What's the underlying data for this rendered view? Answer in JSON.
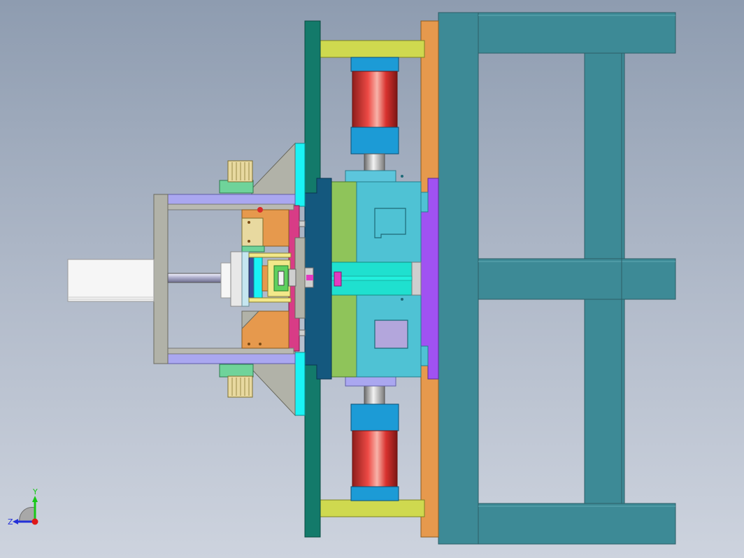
{
  "viewport": {
    "background_top": "#8e9cb0",
    "background_bottom": "#cdd3de"
  },
  "axes": {
    "y_label": "Y",
    "z_label": "Z",
    "y_color": "#17c817",
    "z_color": "#2430d8",
    "x_color": "#e01818"
  },
  "colors": {
    "frame_teal": "#3d8a96",
    "orange_plate": "#e6994d",
    "dark_green_plate": "#137a6a",
    "yellow_clamp": "#cfd94f",
    "cylinder_red": "#d9322f",
    "cylinder_blue": "#1c9bd6",
    "mold_cyan": "#4fc2d4",
    "mold_green": "#8fc45a",
    "purple_plate": "#a052f2",
    "navy_plate": "#14587e",
    "cyan_stripe": "#1af3f5",
    "lavender_rail": "#aaa7f0",
    "gray_plate": "#b1b2a8",
    "magenta_plate": "#d83c86"
  }
}
